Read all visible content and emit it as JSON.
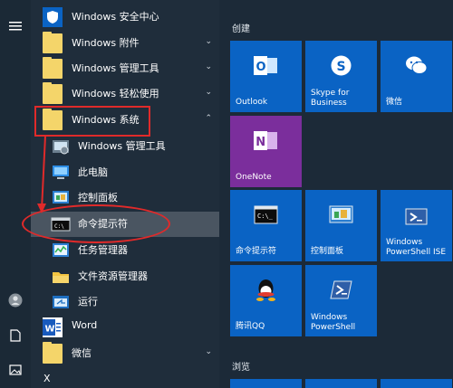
{
  "start_menu": {
    "app_list": [
      {
        "label": "Windows 安全中心",
        "icon": "shield-icon",
        "chevron": ""
      },
      {
        "label": "Windows 附件",
        "icon": "folder-icon",
        "chevron": "⌄"
      },
      {
        "label": "Windows 管理工具",
        "icon": "folder-icon",
        "chevron": "⌄"
      },
      {
        "label": "Windows 轻松使用",
        "icon": "folder-icon",
        "chevron": "⌄"
      },
      {
        "label": "Windows 系统",
        "icon": "folder-icon",
        "chevron": "⌃"
      },
      {
        "label": "Windows 管理工具",
        "icon": "admin-tools-icon",
        "chevron": ""
      },
      {
        "label": "此电脑",
        "icon": "computer-icon",
        "chevron": ""
      },
      {
        "label": "控制面板",
        "icon": "control-panel-icon",
        "chevron": ""
      },
      {
        "label": "命令提示符",
        "icon": "cmd-icon",
        "chevron": ""
      },
      {
        "label": "任务管理器",
        "icon": "task-manager-icon",
        "chevron": ""
      },
      {
        "label": "文件资源管理器",
        "icon": "file-explorer-icon",
        "chevron": ""
      },
      {
        "label": "运行",
        "icon": "run-icon",
        "chevron": ""
      },
      {
        "label": "Word",
        "icon": "word-icon",
        "chevron": ""
      },
      {
        "label": "微信",
        "icon": "folder-icon",
        "chevron": "⌄"
      },
      {
        "label": "X",
        "icon": "",
        "chevron": ""
      }
    ],
    "sections": {
      "create": "创建",
      "browse": "浏览"
    },
    "tiles": [
      {
        "label": "Outlook",
        "icon": "outlook-icon",
        "color": "#0a63c4"
      },
      {
        "label": "Skype for Business",
        "icon": "skype-icon",
        "color": "#0a63c4"
      },
      {
        "label": "微信",
        "icon": "wechat-icon",
        "color": "#0a63c4"
      },
      {
        "label": "OneNote",
        "icon": "onenote-icon",
        "color": "#7b2e9c"
      },
      {
        "label": "命令提示符",
        "icon": "cmd-icon",
        "color": "#0a63c4"
      },
      {
        "label": "控制面板",
        "icon": "control-panel-icon",
        "color": "#0a63c4"
      },
      {
        "label": "Windows PowerShell ISE",
        "icon": "powershell-ise-icon",
        "color": "#0a63c4"
      },
      {
        "label": "腾讯QQ",
        "icon": "qq-icon",
        "color": "#0a63c4"
      },
      {
        "label": "Windows PowerShell",
        "icon": "powershell-icon",
        "color": "#0a63c4"
      }
    ],
    "colors": {
      "accent": "#0a63c4",
      "annotation": "#e02a2a"
    }
  }
}
